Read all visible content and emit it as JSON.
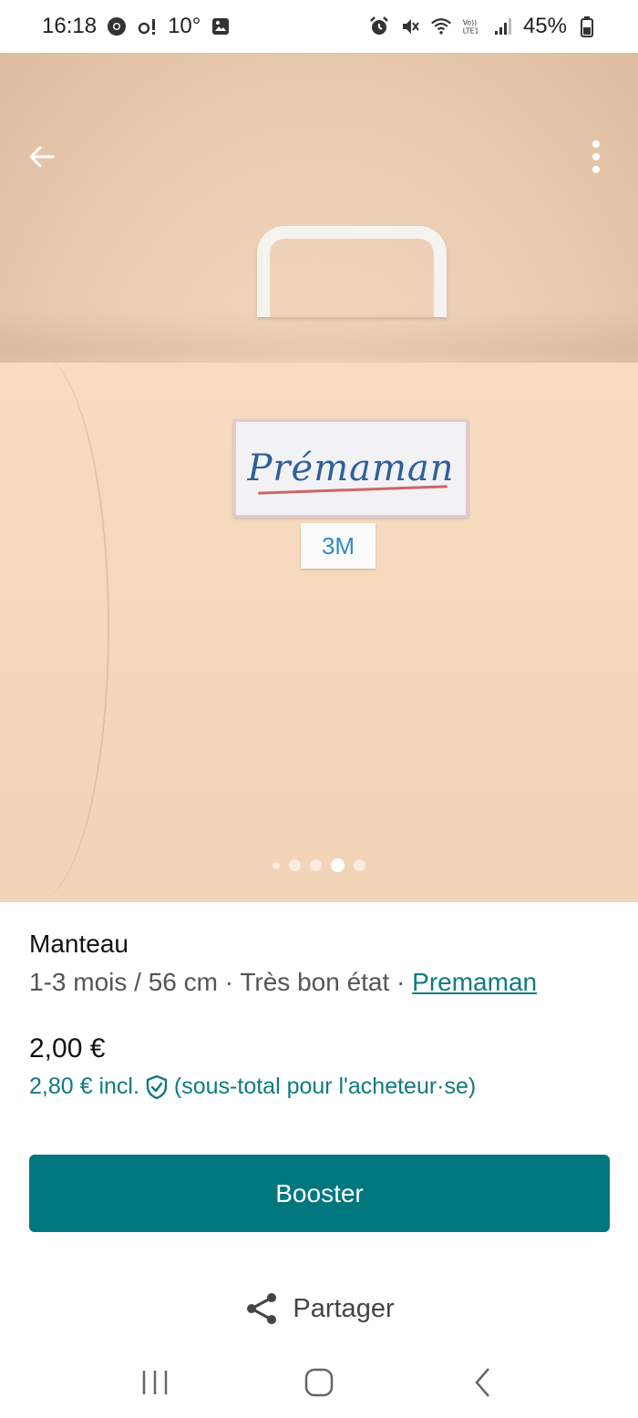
{
  "status_bar": {
    "time": "16:18",
    "notification_temp": "10°",
    "battery": "45%"
  },
  "photo": {
    "brand_label": "Prémaman",
    "size_label": "3M",
    "carousel": {
      "count": 5,
      "active_index": 3
    }
  },
  "item": {
    "title": "Manteau",
    "meta_prefix": "1-3 mois / 56 cm · Très bon état · ",
    "brand": "Premaman",
    "price": "2,00 €",
    "price_incl": "2,80 € incl.",
    "price_incl_note": "(sous-total pour l'acheteur·se)"
  },
  "actions": {
    "booster_label": "Booster",
    "share_label": "Partager"
  },
  "icons": {
    "back": "arrow-left-icon",
    "more": "more-vertical-icon",
    "share": "share-icon",
    "protection": "shield-check-icon"
  },
  "colors": {
    "accent": "#00777f",
    "link": "#0f7a80"
  }
}
